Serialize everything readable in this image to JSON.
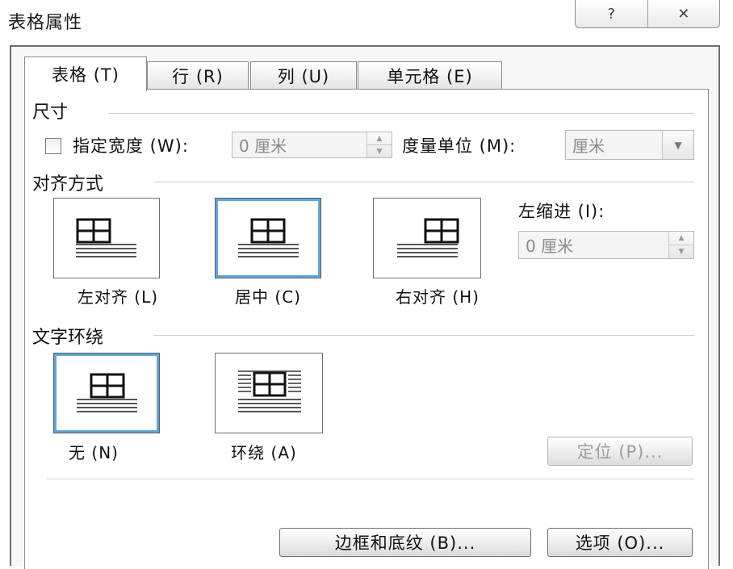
{
  "dialog": {
    "title": "表格属性",
    "help_glyph": "?",
    "close_glyph": "✕"
  },
  "tabs": [
    {
      "label": "表格 (T)",
      "active": true
    },
    {
      "label": "行 (R)",
      "active": false
    },
    {
      "label": "列 (U)",
      "active": false
    },
    {
      "label": "单元格 (E)",
      "active": false
    }
  ],
  "size": {
    "group_label": "尺寸",
    "specify_width_label": "指定宽度 (W):",
    "specify_width_checked": false,
    "width_value": "0 厘米",
    "measure_label": "度量单位 (M):",
    "measure_value": "厘米"
  },
  "alignment": {
    "group_label": "对齐方式",
    "options": [
      {
        "label": "左对齐 (L)",
        "selected": false,
        "icon": "table-align-left-icon"
      },
      {
        "label": "居中 (C)",
        "selected": true,
        "icon": "table-align-center-icon"
      },
      {
        "label": "右对齐 (H)",
        "selected": false,
        "icon": "table-align-right-icon"
      }
    ],
    "indent_label": "左缩进 (I):",
    "indent_value": "0 厘米"
  },
  "wrapping": {
    "group_label": "文字环绕",
    "options": [
      {
        "label": "无 (N)",
        "selected": true,
        "icon": "wrap-none-icon"
      },
      {
        "label": "环绕 (A)",
        "selected": false,
        "icon": "wrap-around-icon"
      }
    ],
    "position_button": "定位 (P)..."
  },
  "footer": {
    "borders_button": "边框和底纹 (B)...",
    "options_button": "选项 (O)..."
  },
  "colors": {
    "selection_blue": "#5ea6d8",
    "border_gray": "#8c8c8c",
    "disabled_text": "#9c9c9c"
  }
}
